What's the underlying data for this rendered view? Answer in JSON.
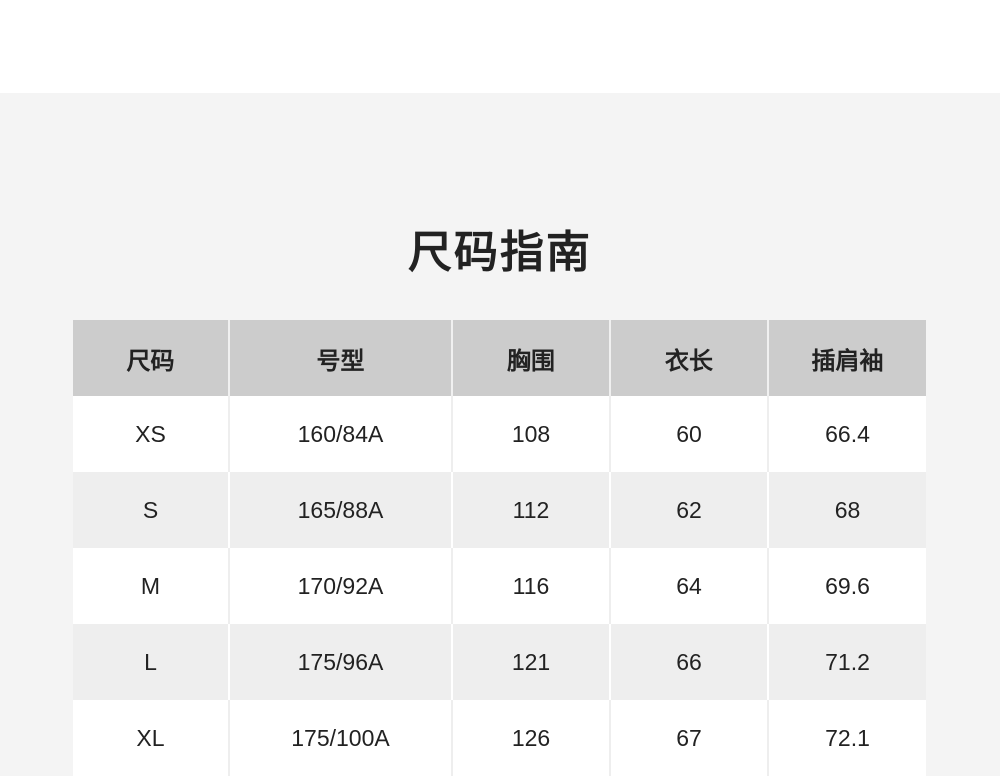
{
  "page": {
    "title": "尺码指南"
  },
  "table": {
    "headers": [
      "尺码",
      "号型",
      "胸围",
      "衣长",
      "插肩袖"
    ],
    "rows": [
      [
        "XS",
        "160/84A",
        "108",
        "60",
        "66.4"
      ],
      [
        "S",
        "165/88A",
        "112",
        "62",
        "68"
      ],
      [
        "M",
        "170/92A",
        "116",
        "64",
        "69.6"
      ],
      [
        "L",
        "175/96A",
        "121",
        "66",
        "71.2"
      ],
      [
        "XL",
        "175/100A",
        "126",
        "67",
        "72.1"
      ]
    ]
  },
  "colors": {
    "header_bg": "#cccccc",
    "panel_bg": "#f4f4f4",
    "row_alt_bg": "#eeeeee",
    "text": "#222222"
  }
}
